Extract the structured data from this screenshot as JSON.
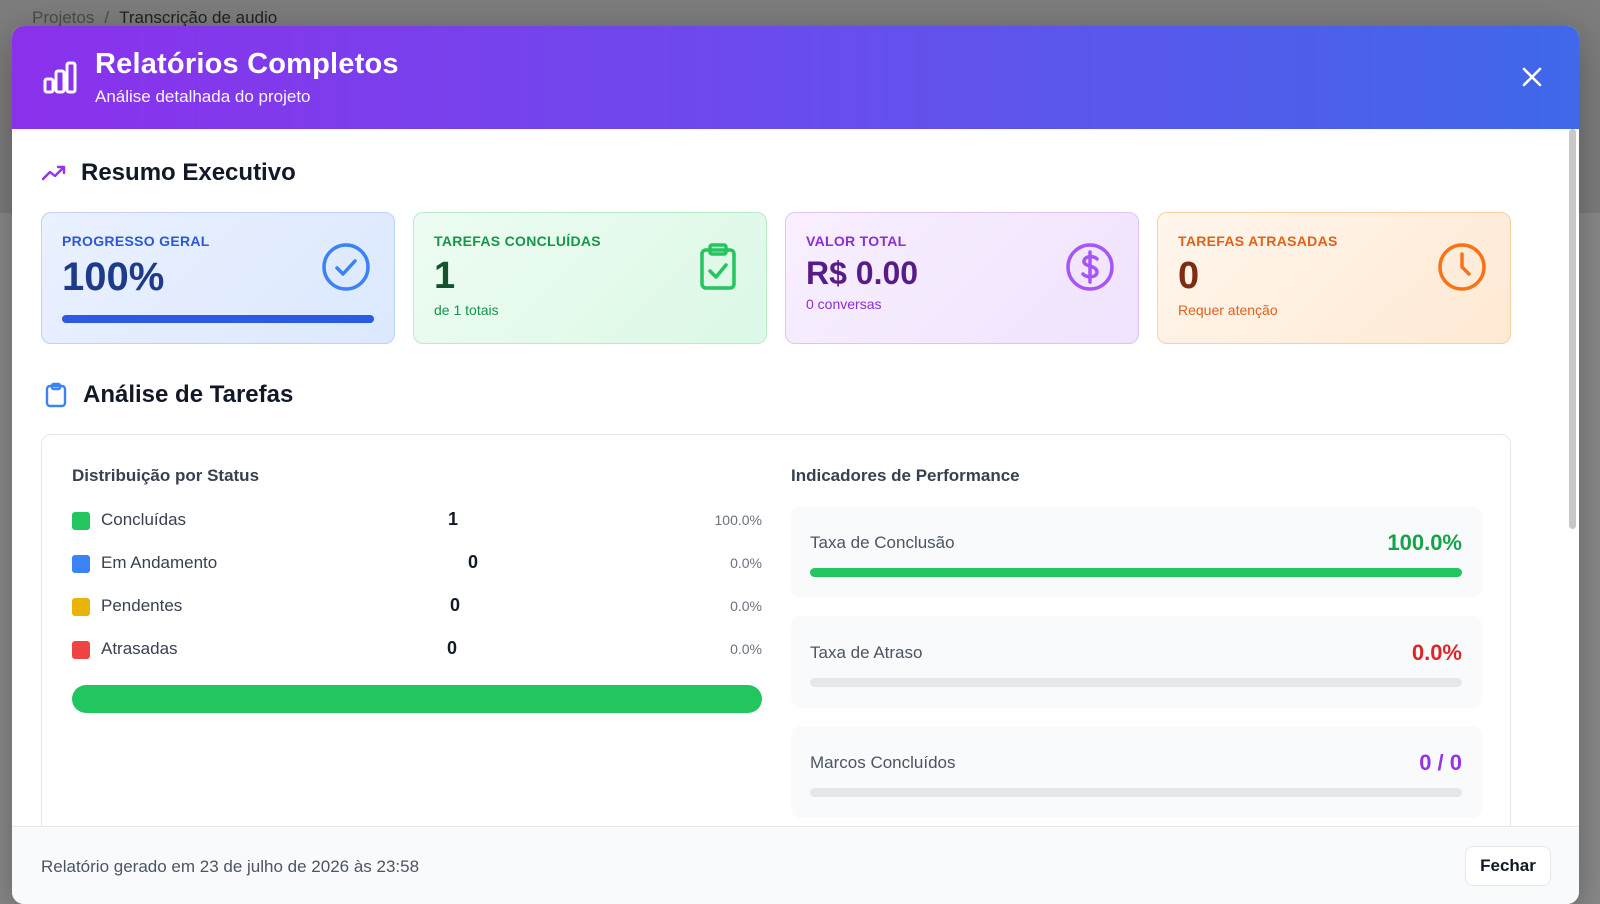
{
  "breadcrumb": {
    "parent": "Projetos",
    "separator": "/",
    "current": "Transcrição de audio"
  },
  "modal": {
    "title": "Relatórios Completos",
    "subtitle": "Análise detalhada do projeto"
  },
  "summary": {
    "title": "Resumo Executivo",
    "cards": {
      "progress": {
        "label": "PROGRESSO GERAL",
        "value": "100%",
        "progress_fraction": 1.0,
        "icon": "check-circle-icon"
      },
      "completed": {
        "label": "TAREFAS CONCLUÍDAS",
        "value": "1",
        "sub": "de 1 totais",
        "icon": "clipboard-check-icon"
      },
      "total_value": {
        "label": "VALOR TOTAL",
        "value": "R$ 0.00",
        "sub": "0 conversas",
        "icon": "dollar-circle-icon"
      },
      "late": {
        "label": "TAREFAS ATRASADAS",
        "value": "0",
        "sub": "Requer atenção",
        "icon": "clock-icon"
      }
    }
  },
  "tasks": {
    "title": "Análise de Tarefas",
    "distribution": {
      "title": "Distribuição por Status",
      "rows": [
        {
          "name": "Concluídas",
          "count": "1",
          "pct": "100.0%",
          "color": "#22c55e"
        },
        {
          "name": "Em Andamento",
          "count": "0",
          "pct": "0.0%",
          "color": "#3b82f6"
        },
        {
          "name": "Pendentes",
          "count": "0",
          "pct": "0.0%",
          "color": "#eab308"
        },
        {
          "name": "Atrasadas",
          "count": "0",
          "pct": "0.0%",
          "color": "#ef4444"
        }
      ]
    },
    "performance": {
      "title": "Indicadores de Performance",
      "items": [
        {
          "label": "Taxa de Conclusão",
          "value": "100.0%",
          "fraction": 1.0,
          "color": "#16a34a"
        },
        {
          "label": "Taxa de Atraso",
          "value": "0.0%",
          "fraction": 0.0,
          "color": "#dc2626"
        },
        {
          "label": "Marcos Concluídos",
          "value": "0 / 0",
          "fraction": 0.0,
          "color": "#9333ea"
        }
      ]
    }
  },
  "footer": {
    "generated": "Relatório gerado em 23 de julho de 2026 às 23:58",
    "close_label": "Fechar"
  }
}
